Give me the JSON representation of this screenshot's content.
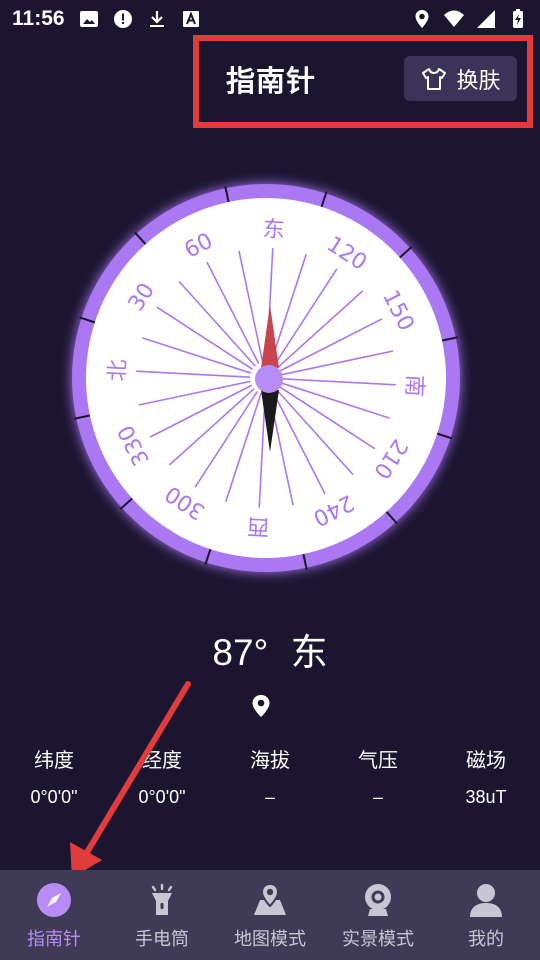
{
  "status_bar": {
    "time": "11:56"
  },
  "header": {
    "title": "指南针",
    "skin_label": "换肤"
  },
  "compass": {
    "dial_labels": [
      "东",
      "120",
      "150",
      "南",
      "210",
      "240",
      "西",
      "300",
      "330",
      "北",
      "30",
      "60"
    ],
    "colors": {
      "ring": "#a978f2",
      "face": "#ffffff",
      "needle_north": "#c8454f",
      "needle_south": "#1a1a1a",
      "text": "#a978f2"
    }
  },
  "reading": {
    "degrees": "87°",
    "direction": "东"
  },
  "stats": [
    {
      "label": "纬度",
      "value": "0°0'0\""
    },
    {
      "label": "经度",
      "value": "0°0'0\""
    },
    {
      "label": "海拔",
      "value": "–"
    },
    {
      "label": "气压",
      "value": "–"
    },
    {
      "label": "磁场",
      "value": "38uT"
    }
  ],
  "tabs": [
    {
      "label": "指南针",
      "icon": "compass-icon"
    },
    {
      "label": "手电筒",
      "icon": "flashlight-icon"
    },
    {
      "label": "地图模式",
      "icon": "map-icon"
    },
    {
      "label": "实景模式",
      "icon": "camera-icon"
    },
    {
      "label": "我的",
      "icon": "person-icon"
    }
  ]
}
